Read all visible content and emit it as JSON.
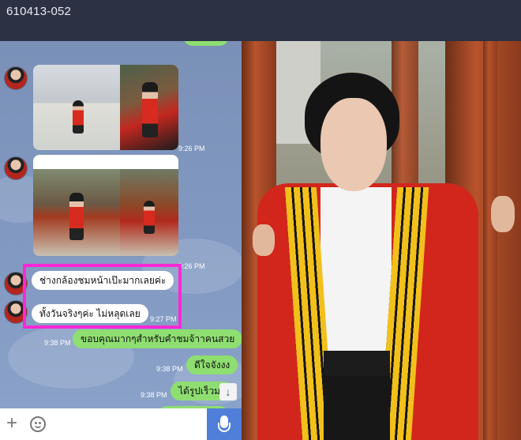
{
  "window": {
    "title": "610413-052"
  },
  "messages": [
    {
      "type": "photo",
      "time": "9:26 PM"
    },
    {
      "type": "photo",
      "time": "9:26 PM"
    },
    {
      "type": "text",
      "direction": "in",
      "text": "ช่างกล้องชมหน้าเป๊ะมากเลยค่ะ"
    },
    {
      "type": "text",
      "direction": "in",
      "text": "ทั้งวันจริงๆค่ะ  ไม่หลุดเลย",
      "time": "9:27 PM"
    },
    {
      "type": "text",
      "direction": "out",
      "text": "ขอบคุณมากๆสำหรับคำชมจ้าาคนสวย",
      "time": "9:38 PM"
    },
    {
      "type": "text",
      "direction": "out",
      "text": "ดีใจจังงง",
      "time": "9:38 PM"
    },
    {
      "type": "text",
      "direction": "out",
      "text": "ได้รูปเร็วมา",
      "time": "9:38 PM"
    }
  ],
  "scroll_bottom": {
    "glyph": "↓"
  },
  "input_bar": {
    "plus_glyph": "+"
  },
  "icons": [
    "plus-icon",
    "emoji-icon",
    "mic-icon",
    "arrow-down-icon"
  ],
  "colors": {
    "header": "#2c3144",
    "chat_bg": "#7f95bc",
    "outgoing_bubble": "#8ede71",
    "highlight": "#ff27d6",
    "mic": "#4f7fd9"
  }
}
